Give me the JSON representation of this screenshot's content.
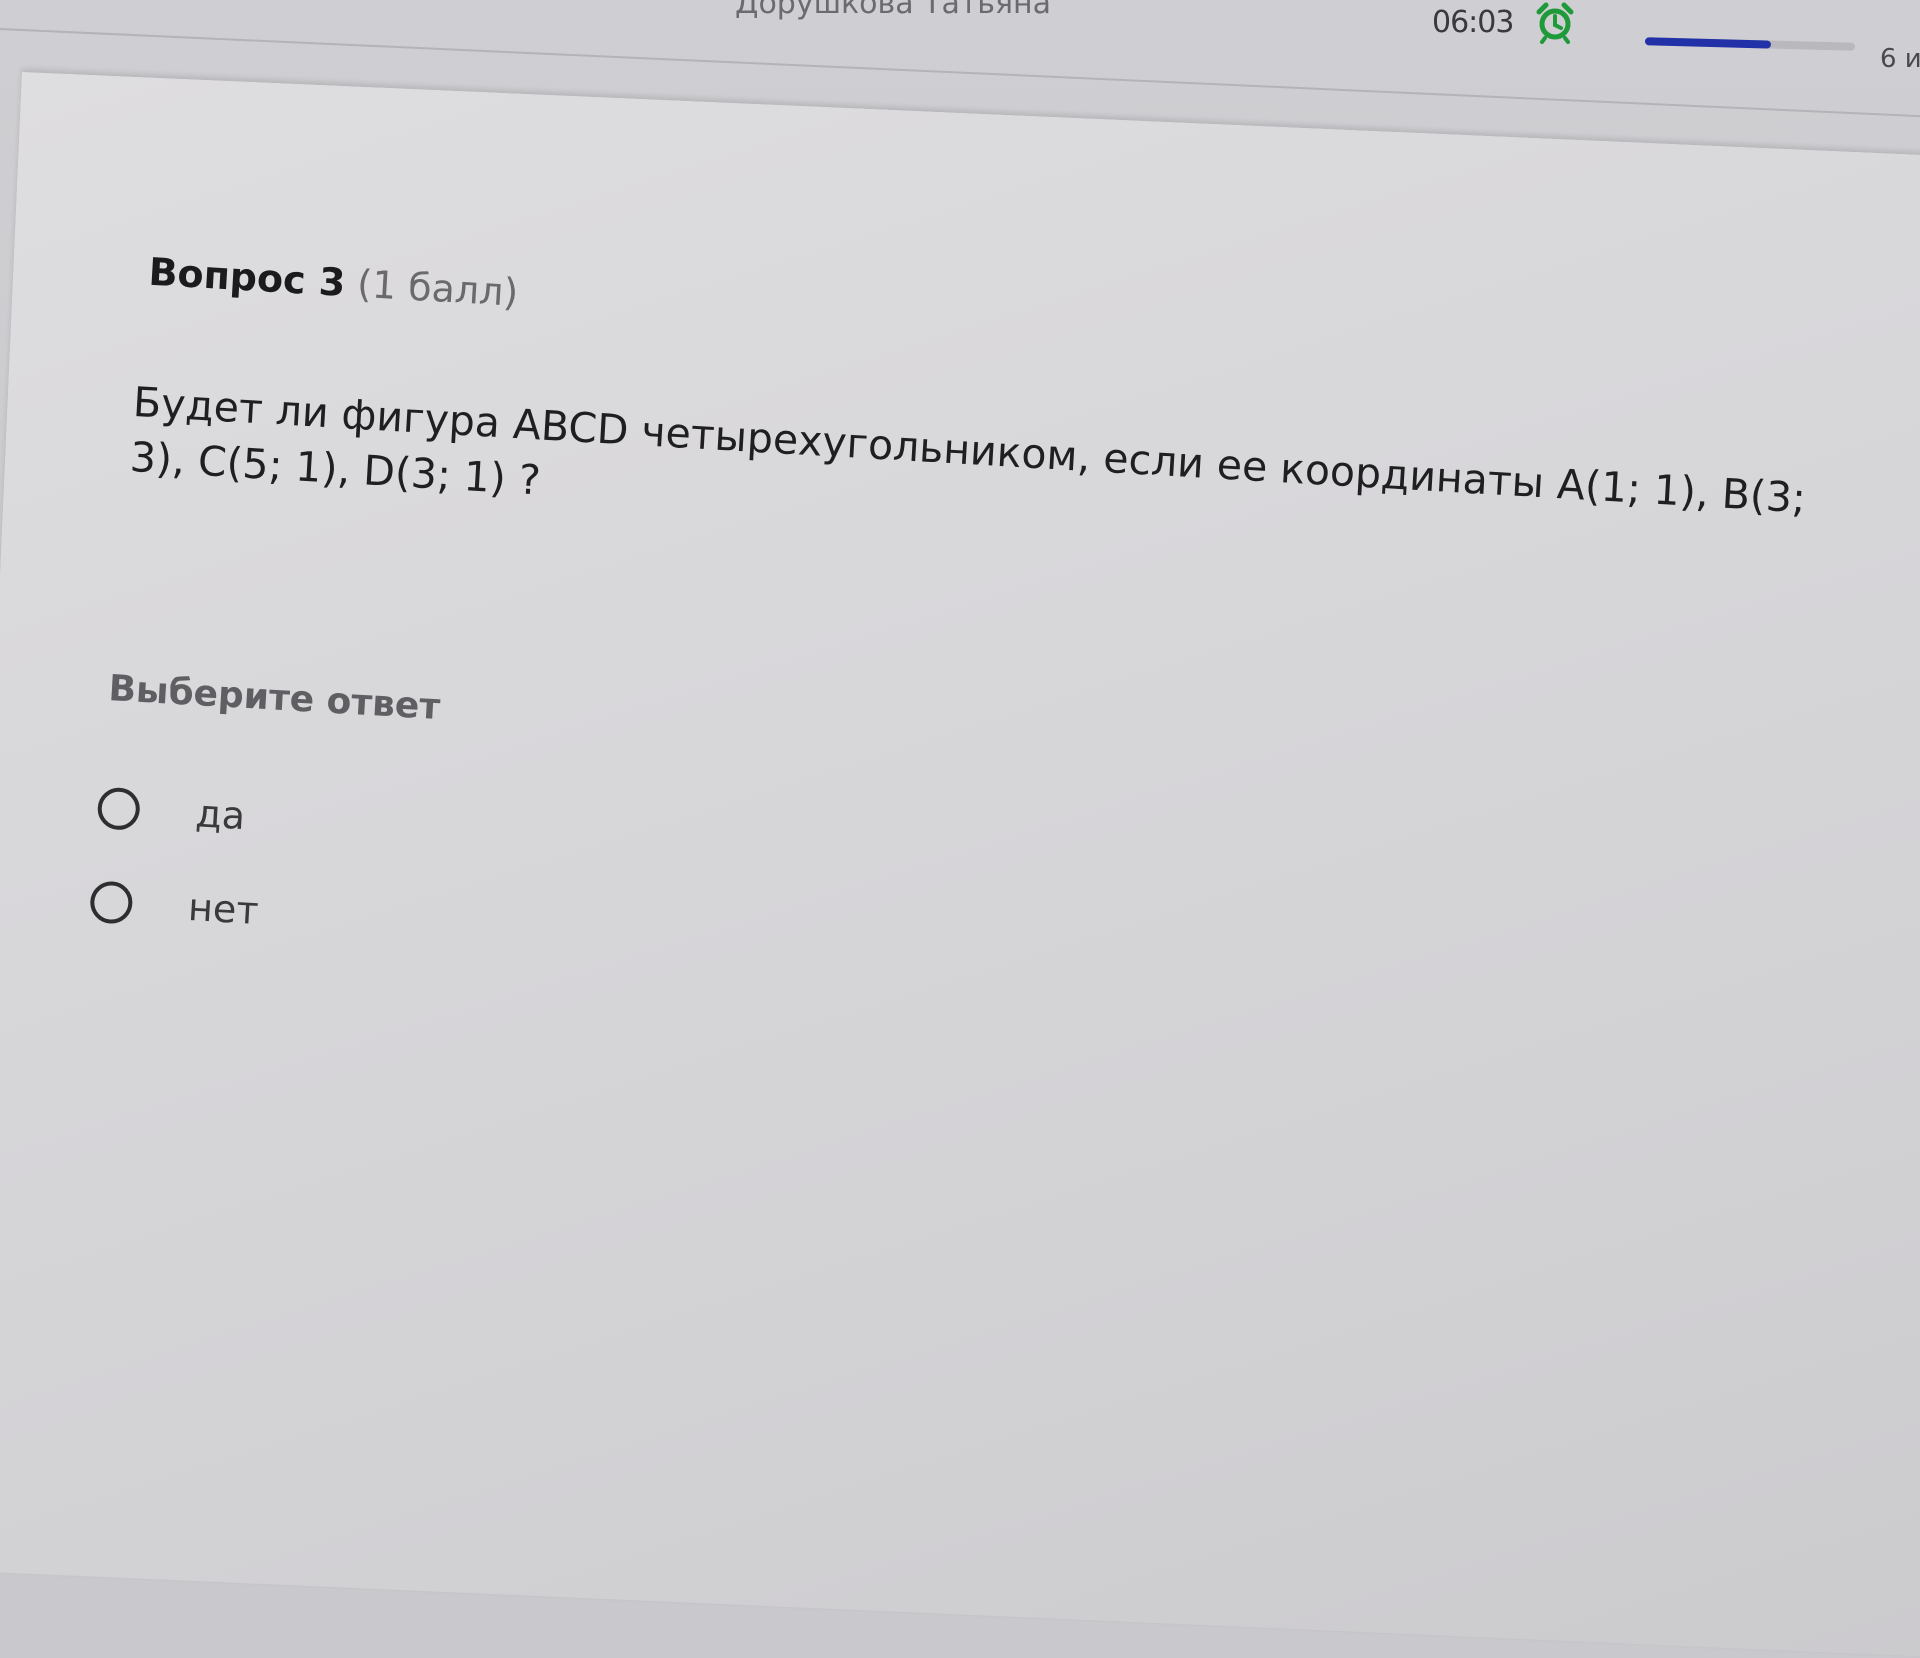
{
  "header": {
    "user_name": "Дорушкова Татьяна",
    "timer": "06:03",
    "progress_fraction": 0.6,
    "progress_label": "6 и"
  },
  "question": {
    "number_label": "Вопрос 3",
    "points_label": "(1 балл)",
    "text": "Будет ли фигура ABCD четырехугольником, если ее координаты A(1; 1), B(3; 3), C(5; 1), D(3; 1) ?"
  },
  "answer": {
    "prompt": "Выберите ответ",
    "options": [
      {
        "label": "да",
        "selected": false
      },
      {
        "label": "нет",
        "selected": false
      }
    ]
  },
  "colors": {
    "accent": "#2231a8",
    "timer_icon": "#1f9a3a"
  }
}
